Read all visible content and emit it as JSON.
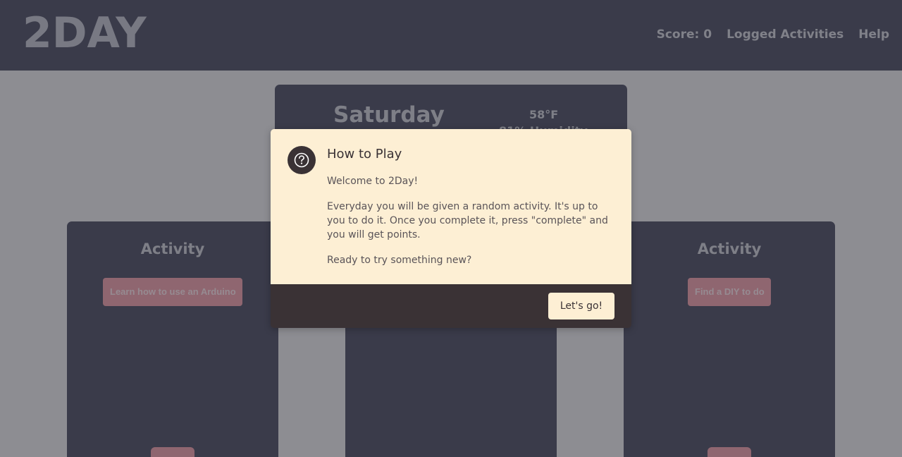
{
  "header": {
    "logo": "2DAY",
    "nav": {
      "score": "Score: 0",
      "logged_activities": "Logged Activities",
      "help": "Help"
    }
  },
  "day_card": {
    "day": "Saturday",
    "temperature": "58°F",
    "humidity": "81% Humidity"
  },
  "activities": {
    "left": {
      "title": "Activity",
      "suggestion": "Learn how to use an Arduino"
    },
    "right": {
      "title": "Activity",
      "suggestion": "Find a DIY to do"
    }
  },
  "modal": {
    "icon": "question-circle-icon",
    "title": "How to Play",
    "paragraphs": [
      "Welcome to 2Day!",
      "Everyday you will be given a random activity. It's up to you to do it. Once you complete it, press \"complete\" and you will get points.",
      "Ready to try something new?"
    ],
    "button_label": "Let's go!"
  },
  "colors": {
    "header_bg": "#5d5f70",
    "modal_body_bg": "#fdefd4",
    "modal_footer_bg": "#3a3235",
    "pill_bg": "#f0aab2"
  }
}
